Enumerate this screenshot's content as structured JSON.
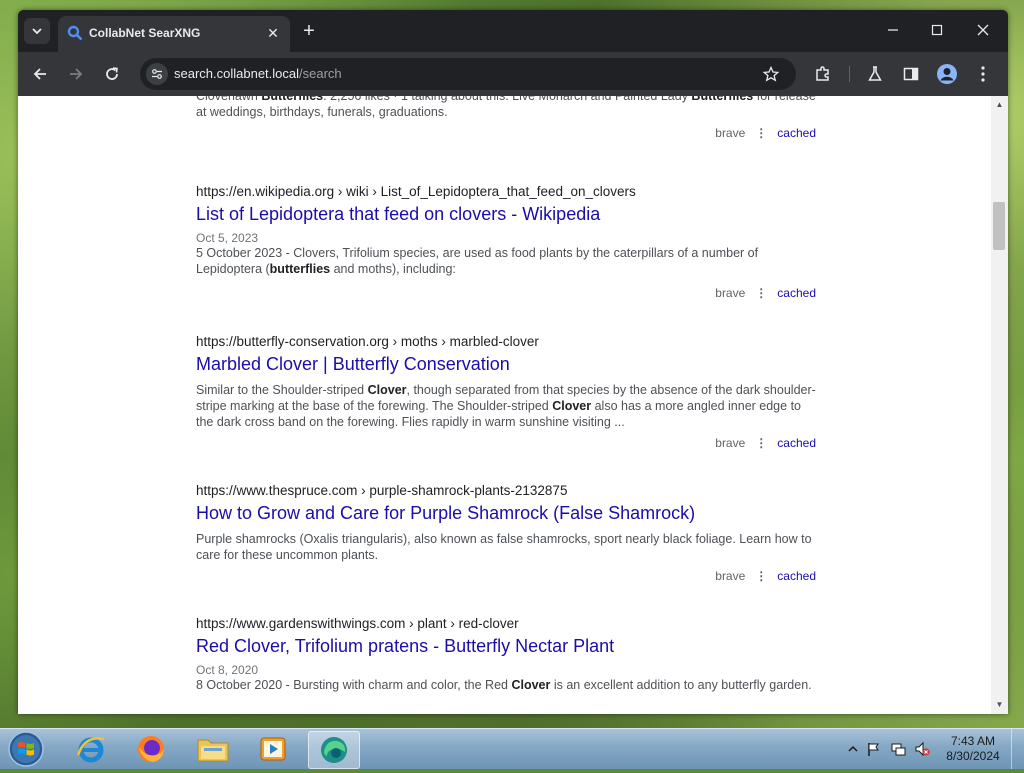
{
  "browser": {
    "tab_title": "CollabNet SearXNG",
    "url_host": "search.collabnet.local",
    "url_path": "/search"
  },
  "results": [
    {
      "snippet_html": "Cloverlawn <b>Butterflies</b>. 2,256 likes · 1 talking about this. Live Monarch and Painted Lady <b>Butterflies</b> for release at weddings, birthdays, funerals, graduations.",
      "engine": "brave",
      "cached": "cached"
    },
    {
      "url": "https://en.wikipedia.org",
      "breadcrumb": "› wiki › List_of_Lepidoptera_that_feed_on_clovers",
      "title": "List of Lepidoptera that feed on clovers - Wikipedia",
      "date": "Oct 5, 2023",
      "snippet_html": "5 October 2023 - Clovers, Trifolium species, are used as food plants by the caterpillars of a number of Lepidoptera (<b>butterflies</b> and moths), including:",
      "engine": "brave",
      "cached": "cached"
    },
    {
      "url": "https://butterfly-conservation.org",
      "breadcrumb": "› moths › marbled-clover",
      "title": "Marbled Clover | Butterfly Conservation",
      "snippet_html": "Similar to the Shoulder-striped <b>Clover</b>, though separated from that species by the absence of the dark shoulder-stripe marking at the base of the forewing. The Shoulder-striped <b>Clover</b> also has a more angled inner edge to the dark cross band on the forewing. Flies rapidly in warm sunshine visiting ...",
      "engine": "brave",
      "cached": "cached"
    },
    {
      "url": "https://www.thespruce.com",
      "breadcrumb": "› purple-shamrock-plants-2132875",
      "title": "How to Grow and Care for Purple Shamrock (False Shamrock)",
      "snippet_html": "Purple shamrocks (Oxalis triangularis), also known as false shamrocks, sport nearly black foliage. Learn how to care for these uncommon plants.",
      "engine": "brave",
      "cached": "cached"
    },
    {
      "url": "https://www.gardenswithwings.com",
      "breadcrumb": "› plant › red-clover",
      "title": "Red Clover, Trifolium pratens - Butterfly Nectar Plant",
      "date": "Oct 8, 2020",
      "snippet_html": "8 October 2020 - Bursting with charm and color, the Red <b>Clover</b> is an excellent addition to any butterfly garden."
    }
  ],
  "taskbar": {
    "time": "7:43 AM",
    "date": "8/30/2024"
  },
  "colors": {
    "title_link": "#1a0dab",
    "tab_bg": "#35363a",
    "frame_bg": "#202124"
  }
}
